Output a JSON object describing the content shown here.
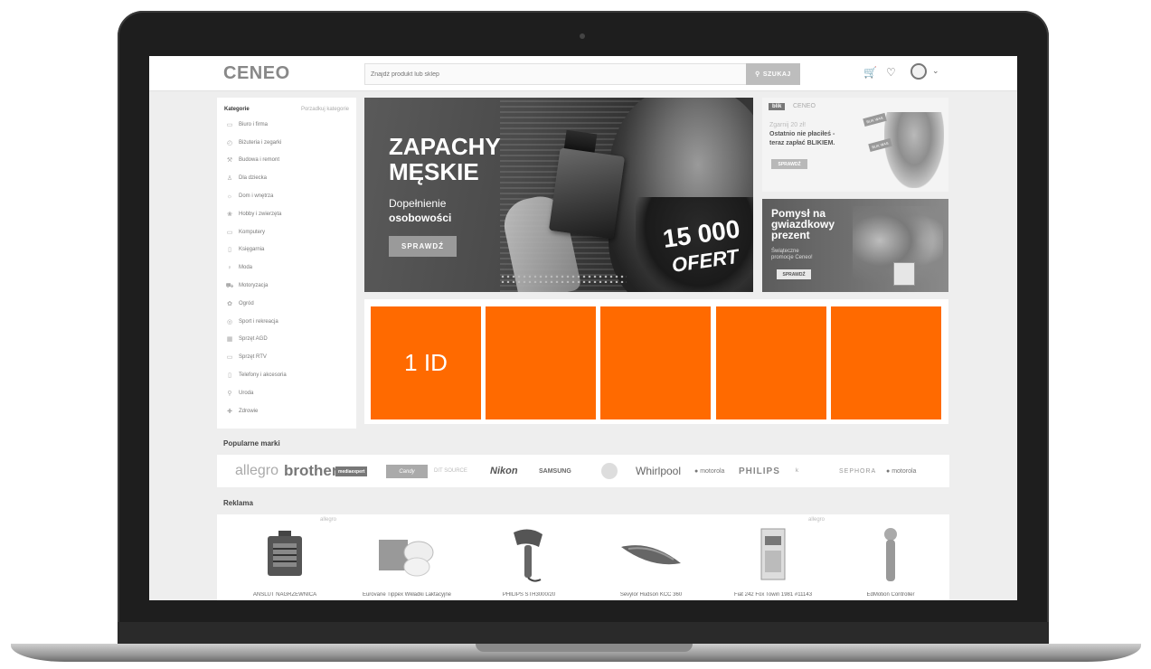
{
  "header": {
    "logo": "CENEO",
    "search_placeholder": "Znajdź produkt lub sklep",
    "search_button": "SZUKAJ",
    "search_icon": "search-icon",
    "cart_icon": "cart-icon",
    "heart_icon": "heart-icon",
    "account_icon": "user-avatar-icon"
  },
  "sidebar": {
    "title": "Kategorie",
    "link": "Porzadkuj kategorie",
    "items": [
      {
        "label": "Biuro i firma",
        "icon": "briefcase-icon"
      },
      {
        "label": "Biżuteria i zegarki",
        "icon": "watch-icon"
      },
      {
        "label": "Budowa i remont",
        "icon": "hammer-icon"
      },
      {
        "label": "Dla dziecka",
        "icon": "stroller-icon"
      },
      {
        "label": "Dom i wnętrza",
        "icon": "lamp-icon"
      },
      {
        "label": "Hobby i zwierzęta",
        "icon": "paw-icon"
      },
      {
        "label": "Komputery",
        "icon": "laptop-icon"
      },
      {
        "label": "Księgarnia",
        "icon": "book-icon"
      },
      {
        "label": "Moda",
        "icon": "dress-icon"
      },
      {
        "label": "Motoryzacja",
        "icon": "car-icon"
      },
      {
        "label": "Ogród",
        "icon": "plant-icon"
      },
      {
        "label": "Sport i rekreacja",
        "icon": "ball-icon"
      },
      {
        "label": "Sprzęt AGD",
        "icon": "washer-icon"
      },
      {
        "label": "Sprzęt RTV",
        "icon": "tv-icon"
      },
      {
        "label": "Telefony i akcesoria",
        "icon": "phone-icon"
      },
      {
        "label": "Uroda",
        "icon": "lipstick-icon"
      },
      {
        "label": "Zdrowie",
        "icon": "health-icon"
      }
    ]
  },
  "hero": {
    "title_line1": "ZAPACHY",
    "title_line2": "MĘSKIE",
    "subtitle1": "Dopełnienie",
    "subtitle2": "osobowości",
    "button": "SPRAWDŹ",
    "badge_number": "15 000",
    "badge_text": "OFERT"
  },
  "blik_banner": {
    "logo": "blik",
    "brand": "CENEO",
    "line1": "Zgarnij 20 zł!",
    "line2": "Ostatnio nie płaciłeś -",
    "line3": "teraz zapłać BLIKIEM.",
    "button": "SPRAWDŹ",
    "tag1": "BLIK WAS",
    "tag2": "BLIK WAS"
  },
  "gift_banner": {
    "title_line1": "Pomysł na",
    "title_line2": "gwiazdkowy",
    "title_line3": "prezent",
    "sub_line1": "Świąteczne",
    "sub_line2": "promocje Ceneo!",
    "button": "SPRAWDŹ"
  },
  "tiles": [
    {
      "label": "1 ID",
      "color": "#ff6a00"
    },
    {
      "label": "",
      "color": "#ff6a00"
    },
    {
      "label": "",
      "color": "#ff6a00"
    },
    {
      "label": "",
      "color": "#ff6a00"
    },
    {
      "label": "",
      "color": "#ff6a00"
    }
  ],
  "brands_section": {
    "title": "Popularne marki",
    "brands": [
      "allegro",
      "brother",
      "mediaexpert",
      "Candy",
      "DIT SOURCE",
      "Nikon",
      "SAMSUNG",
      "",
      "Whirlpool",
      "motorola",
      "PHILIPS",
      "",
      "SEPHORA",
      "motorola"
    ]
  },
  "ads_section": {
    "title": "Reklama",
    "items": [
      {
        "name": "ANSLUT NAGRZEWNICA",
        "store": "allegro",
        "icon": "heater-icon"
      },
      {
        "name": "Eurovane Tippex Wkładki Laktacyjne",
        "store": "",
        "icon": "breast-pads-icon"
      },
      {
        "name": "PHILIPS STH3000/20",
        "store": "",
        "icon": "steamer-icon"
      },
      {
        "name": "Sevylor Hudson KCC 360",
        "store": "",
        "icon": "kayak-icon"
      },
      {
        "name": "Fiat 242 Fox Towin 1981 #11143",
        "store": "allegro",
        "icon": "model-car-icon"
      },
      {
        "name": "EdMotion Controller",
        "store": "",
        "icon": "controller-icon"
      }
    ]
  }
}
